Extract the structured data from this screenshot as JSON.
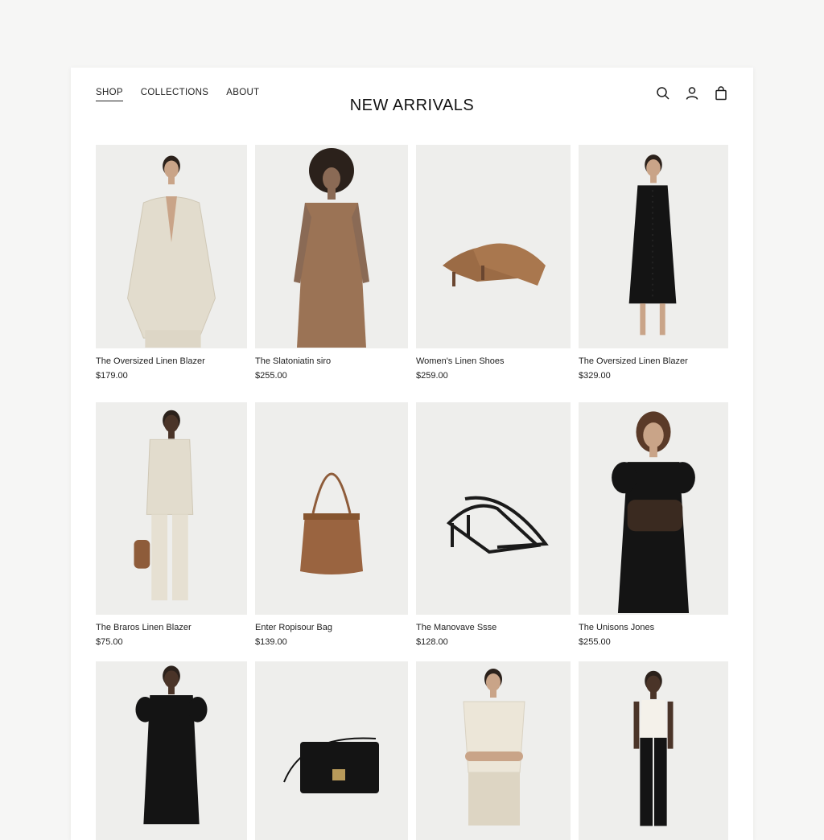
{
  "nav": {
    "items": [
      {
        "label": "SHOP",
        "active": true
      },
      {
        "label": "COLLECTIONS",
        "active": false
      },
      {
        "label": "ABOUT",
        "active": false
      }
    ]
  },
  "page_title": "NEW ARRIVALS",
  "header_icons": [
    "search-icon",
    "account-icon",
    "shopping-bag-icon"
  ],
  "colors": {
    "page_bg": "#f6f6f5",
    "card_bg": "#eeeeec",
    "linen": "#e2dccd",
    "camel": "#9b6b45",
    "black": "#141414"
  },
  "products": [
    {
      "name": "The Oversized Linen Blazer",
      "price": "$179.00",
      "image": "linen-blazer-model"
    },
    {
      "name": "The Slatoniatin siro",
      "price": "$255.00",
      "image": "brown-slip-dress-model"
    },
    {
      "name": "Women's Linen Shoes",
      "price": "$259.00",
      "image": "tan-slingback-heels"
    },
    {
      "name": "The Oversized Linen Blazer",
      "price": "$329.00",
      "image": "black-button-dress-model"
    },
    {
      "name": "The Braros Linen Blazer",
      "price": "$75.00",
      "image": "linen-suit-model-with-bag"
    },
    {
      "name": "Enter Ropisour Bag",
      "price": "$139.00",
      "image": "tan-bucket-bag"
    },
    {
      "name": "The Manovave Ssse",
      "price": "$128.00",
      "image": "black-strappy-sandals"
    },
    {
      "name": "The Unisons Jones",
      "price": "$255.00",
      "image": "black-puff-sleeve-dress-model"
    },
    {
      "name": "",
      "price": "",
      "image": "black-smocked-dress-model"
    },
    {
      "name": "",
      "price": "",
      "image": "black-crossbody-bag"
    },
    {
      "name": "",
      "price": "",
      "image": "cream-tee-linen-trousers-model"
    },
    {
      "name": "",
      "price": "",
      "image": "white-tank-black-trousers-model"
    }
  ]
}
